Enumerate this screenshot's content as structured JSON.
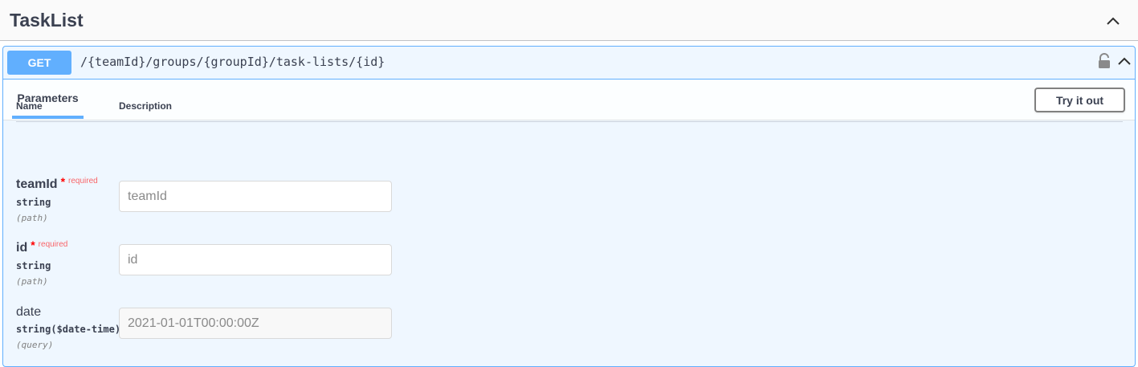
{
  "tag": {
    "title": "TaskList"
  },
  "operation": {
    "method": "GET",
    "path": "/{teamId}/groups/{groupId}/task-lists/{id}",
    "color": "#61affe"
  },
  "params_section": {
    "tab_label": "Parameters",
    "try_button": "Try it out",
    "col_name": "Name",
    "col_description": "Description"
  },
  "parameters": [
    {
      "name": "teamId",
      "required_mark": "*",
      "required_label": "required",
      "type": "string",
      "in": "(path)",
      "placeholder": "teamId"
    },
    {
      "name": "id",
      "required_mark": "*",
      "required_label": "required",
      "type": "string",
      "in": "(path)",
      "placeholder": "id"
    },
    {
      "name": "date",
      "type": "string($date-time)",
      "in": "(query)",
      "placeholder": "2021-01-01T00:00:00Z"
    }
  ],
  "icons": {
    "collapse": "chevron-up-icon",
    "lock": "lock-open-icon"
  }
}
